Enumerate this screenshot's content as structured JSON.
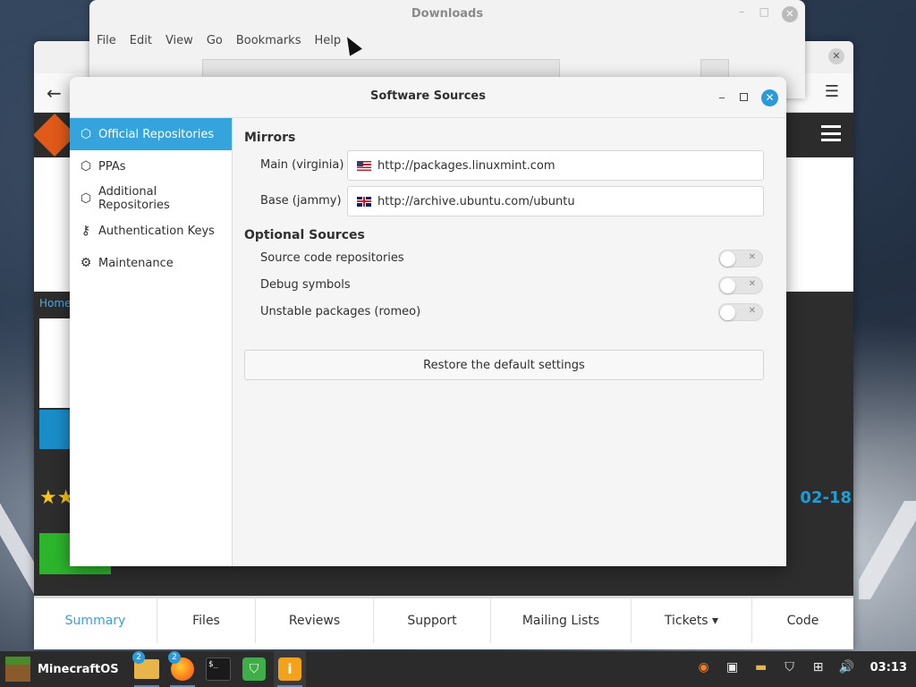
{
  "file_manager": {
    "title": "Downloads",
    "menus": [
      "File",
      "Edit",
      "View",
      "Go",
      "Bookmarks",
      "Help"
    ]
  },
  "browser": {
    "breadcrumb": "Home",
    "date_fragment": "02-18",
    "tabs": [
      "Summary",
      "Files",
      "Reviews",
      "Support",
      "Mailing Lists",
      "Tickets ▾",
      "Code"
    ],
    "active_tab": "Summary"
  },
  "dialog": {
    "title": "Software Sources",
    "sidebar": [
      {
        "label": "Official Repositories",
        "icon": "package-icon",
        "active": true
      },
      {
        "label": "PPAs",
        "icon": "package-icon",
        "active": false
      },
      {
        "label": "Additional Repositories",
        "icon": "package-icon",
        "active": false
      },
      {
        "label": "Authentication Keys",
        "icon": "key-icon",
        "active": false
      },
      {
        "label": "Maintenance",
        "icon": "gear-icon",
        "active": false
      }
    ],
    "mirrors": {
      "heading": "Mirrors",
      "main": {
        "label": "Main (virginia)",
        "url": "http://packages.linuxmint.com",
        "flag": "us-flag-icon"
      },
      "base": {
        "label": "Base (jammy)",
        "url": "http://archive.ubuntu.com/ubuntu",
        "flag": "uk-flag-icon"
      }
    },
    "optional": {
      "heading": "Optional Sources",
      "items": [
        {
          "label": "Source code repositories",
          "enabled": false
        },
        {
          "label": "Debug symbols",
          "enabled": false
        },
        {
          "label": "Unstable packages (romeo)",
          "enabled": false
        }
      ]
    },
    "restore_label": "Restore the default settings",
    "accent_color": "#35a3dc"
  },
  "taskbar": {
    "menu_label": "MinecraftOS",
    "apps": [
      {
        "name": "files-icon",
        "badge": "2"
      },
      {
        "name": "firefox-icon",
        "badge": "2"
      },
      {
        "name": "terminal-icon",
        "badge": ""
      },
      {
        "name": "shield-icon",
        "badge": ""
      },
      {
        "name": "info-icon",
        "badge": ""
      }
    ],
    "time": "03:13"
  }
}
